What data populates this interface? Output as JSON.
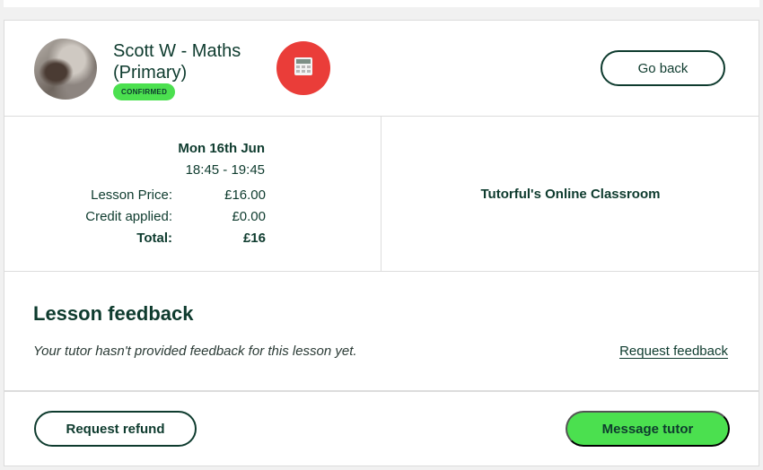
{
  "header": {
    "tutor_name": "Scott W - Maths (Primary)",
    "status_badge": "CONFIRMED",
    "go_back_label": "Go back"
  },
  "lesson": {
    "date": "Mon 16th Jun",
    "time": "18:45 - 19:45",
    "price_label": "Lesson Price:",
    "price_value": "£16.00",
    "credit_label": "Credit applied:",
    "credit_value": "£0.00",
    "total_label": "Total:",
    "total_value": "£16",
    "location": "Tutorful's Online Classroom"
  },
  "feedback": {
    "title": "Lesson feedback",
    "message": "Your tutor hasn't provided feedback for this lesson yet.",
    "request_link": "Request feedback"
  },
  "footer": {
    "refund_label": "Request refund",
    "message_label": "Message tutor"
  },
  "colors": {
    "primary": "#0e3b2e",
    "accent_green": "#4be04f",
    "calc_red": "#ea3d39"
  },
  "icons": {
    "calculator": "calculator-icon"
  }
}
